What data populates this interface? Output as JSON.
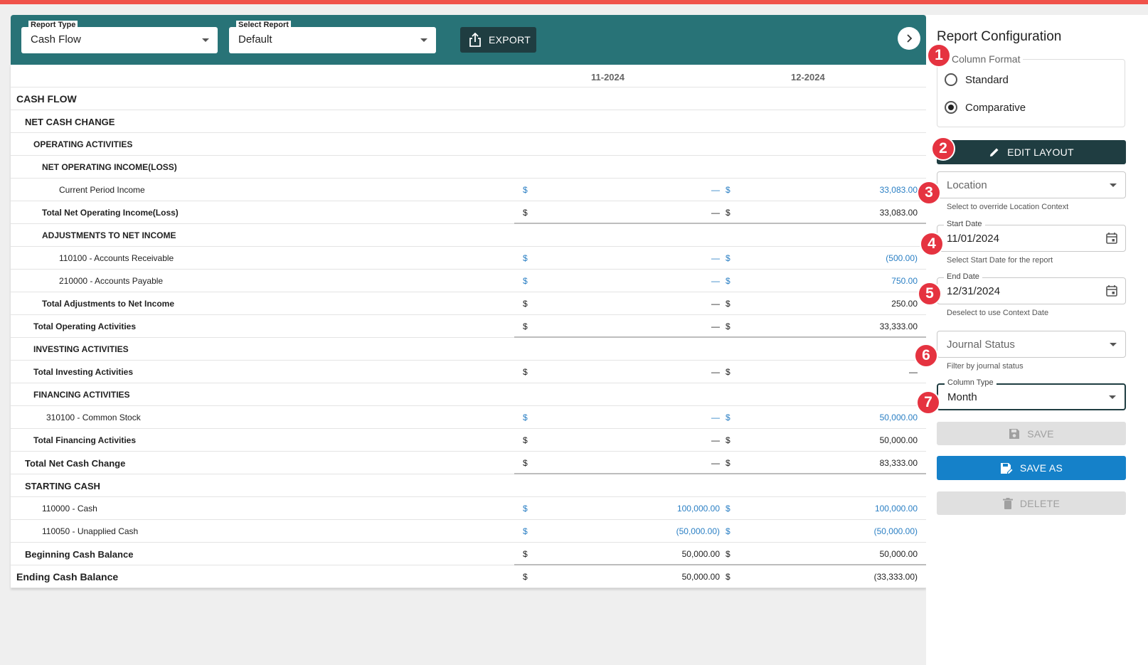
{
  "toolbar": {
    "report_type_label": "Report Type",
    "report_type_value": "Cash Flow",
    "select_report_label": "Select Report",
    "select_report_value": "Default",
    "export_label": "EXPORT"
  },
  "report": {
    "columns": [
      "11-2024",
      "12-2024"
    ],
    "rows": [
      {
        "name": "CASH FLOW",
        "indent": 0,
        "bold": true,
        "size": 14
      },
      {
        "name": "NET CASH CHANGE",
        "indent": 1,
        "bold": true,
        "size": 13
      },
      {
        "name": "OPERATING ACTIVITIES",
        "indent": 2,
        "bold": true
      },
      {
        "name": "NET OPERATING INCOME(LOSS)",
        "indent": 3,
        "bold": true
      },
      {
        "name": "Current Period Income",
        "indent": 4,
        "blue": true,
        "d1": "$",
        "v1": "—",
        "d2": "$",
        "v2": "33,083.00"
      },
      {
        "name": "Total Net Operating Income(Loss)",
        "indent": 3,
        "bold": true,
        "totline": true,
        "d1": "$",
        "v1": "—",
        "d2": "$",
        "v2": "33,083.00"
      },
      {
        "name": "ADJUSTMENTS TO NET INCOME",
        "indent": 3,
        "bold": true
      },
      {
        "name": "110100 - Accounts Receivable",
        "indent": 4,
        "blue": true,
        "d1": "$",
        "v1": "—",
        "d2": "$",
        "v2": "(500.00)"
      },
      {
        "name": "210000 - Accounts Payable",
        "indent": 4,
        "blue": true,
        "d1": "$",
        "v1": "—",
        "d2": "$",
        "v2": "750.00"
      },
      {
        "name": "Total Adjustments to Net Income",
        "indent": 3,
        "bold": true,
        "d1": "$",
        "v1": "—",
        "d2": "$",
        "v2": "250.00"
      },
      {
        "name": "Total Operating Activities",
        "indent": 2,
        "bold": true,
        "totline": true,
        "d1": "$",
        "v1": "—",
        "d2": "$",
        "v2": "33,333.00"
      },
      {
        "name": "INVESTING ACTIVITIES",
        "indent": 2,
        "bold": true
      },
      {
        "name": "Total Investing Activities",
        "indent": 2,
        "bold": true,
        "d1": "$",
        "v1": "—",
        "d2": "$",
        "v2": "—"
      },
      {
        "name": "FINANCING ACTIVITIES",
        "indent": 2,
        "bold": true
      },
      {
        "name": "310100 - Common Stock",
        "indent": 3.5,
        "blue": true,
        "d1": "$",
        "v1": "—",
        "d2": "$",
        "v2": "50,000.00"
      },
      {
        "name": "Total Financing Activities",
        "indent": 2,
        "bold": true,
        "d1": "$",
        "v1": "—",
        "d2": "$",
        "v2": "50,000.00"
      },
      {
        "name": "Total Net Cash Change",
        "indent": 1,
        "bold": true,
        "size": 13,
        "totline": true,
        "d1": "$",
        "v1": "—",
        "d2": "$",
        "v2": "83,333.00"
      },
      {
        "name": "STARTING CASH",
        "indent": 1,
        "bold": true,
        "size": 13
      },
      {
        "name": "110000 - Cash",
        "indent": 3,
        "blue": true,
        "d1": "$",
        "v1": "100,000.00",
        "d2": "$",
        "v2": "100,000.00"
      },
      {
        "name": "110050 - Unapplied Cash",
        "indent": 3,
        "blue": true,
        "d1": "$",
        "v1": "(50,000.00)",
        "d2": "$",
        "v2": "(50,000.00)"
      },
      {
        "name": "Beginning Cash Balance",
        "indent": 1,
        "bold": true,
        "size": 13,
        "totline": true,
        "d1": "$",
        "v1": "50,000.00",
        "d2": "$",
        "v2": "50,000.00"
      },
      {
        "name": "Ending Cash Balance",
        "indent": 0,
        "bold": true,
        "size": 14,
        "d1": "$",
        "v1": "50,000.00",
        "d2": "$",
        "v2": "(33,333.00)"
      }
    ]
  },
  "config": {
    "title": "Report Configuration",
    "column_format_label": "Column Format",
    "option_standard": "Standard",
    "option_comparative": "Comparative",
    "selected_format": "Comparative",
    "edit_layout_label": "EDIT LAYOUT",
    "location_placeholder": "Location",
    "location_help": "Select to override Location Context",
    "start_date_label": "Start Date",
    "start_date_value": "11/01/2024",
    "start_date_help": "Select Start Date for the report",
    "end_date_label": "End Date",
    "end_date_value": "12/31/2024",
    "end_date_help": "Deselect to use Context Date",
    "journal_status_placeholder": "Journal Status",
    "journal_status_help": "Filter by journal status",
    "column_type_label": "Column Type",
    "column_type_value": "Month",
    "save_label": "SAVE",
    "save_as_label": "SAVE AS",
    "delete_label": "DELETE"
  },
  "badges": [
    "1",
    "2",
    "3",
    "4",
    "5",
    "6",
    "7"
  ],
  "colors": {
    "toolbar_teal": "#287377",
    "dark_button": "#1f3d41",
    "link_blue": "#2a7fc4",
    "save_as_blue": "#1581c9",
    "badge_red": "#e53340",
    "top_accent": "#f0524a"
  },
  "icons": {
    "export": "share-upload-icon",
    "expand": "chevron-right-icon",
    "edit": "pencil-icon",
    "calendar": "calendar-icon",
    "save": "floppy-disk-icon",
    "save_as": "floppy-edit-icon",
    "delete": "trash-icon"
  }
}
